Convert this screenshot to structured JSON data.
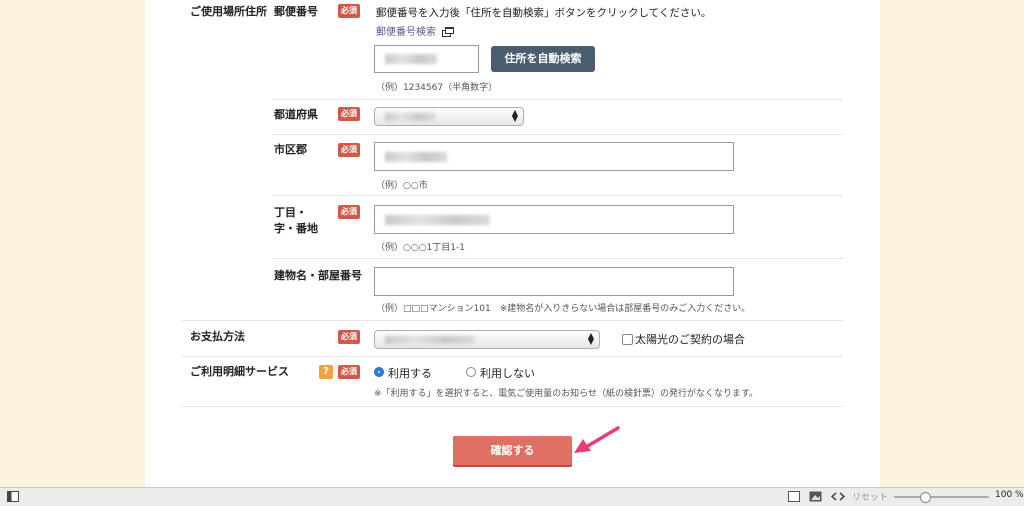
{
  "form": {
    "address_section": {
      "label": "ご使用場所住所",
      "postal": {
        "label": "郵便番号",
        "required": "必須",
        "instruction": "郵便番号を入力後「住所を自動検索」ボタンをクリックしてください。",
        "search_link": "郵便番号検索",
        "search_button": "住所を自動検索",
        "example": "（例）1234567（半角数字）"
      },
      "prefecture": {
        "label": "都道府県",
        "required": "必須"
      },
      "city": {
        "label": "市区郡",
        "required": "必須",
        "example": "（例）○○市"
      },
      "block": {
        "label_line1": "丁目・",
        "label_line2": "字・番地",
        "required": "必須",
        "example": "（例）○○○1丁目1-1"
      },
      "building": {
        "label": "建物名・部屋番号",
        "example": "（例）□□□マンション101　※建物名が入りきらない場合は部屋番号のみご入力ください。"
      }
    },
    "payment": {
      "label": "お支払方法",
      "required": "必須",
      "checkbox_label": "太陽光のご契約の場合"
    },
    "statement": {
      "label": "ご利用明細サービス",
      "help": "?",
      "required": "必須",
      "option_use": "利用する",
      "option_not_use": "利用しない",
      "note": "※「利用する」を選択すると、電気ご使用量のお知らせ（紙の検針票）の発行がなくなります。"
    },
    "confirm_button": "確認する"
  },
  "statusbar": {
    "reset": "リセット",
    "zoom": "100 %",
    "zoom_level": 0.3
  },
  "colors": {
    "accent": "#e07063",
    "dark_button": "#4a5c6e",
    "required_badge": "#d0594a",
    "arrow": "#ea3a7a"
  }
}
